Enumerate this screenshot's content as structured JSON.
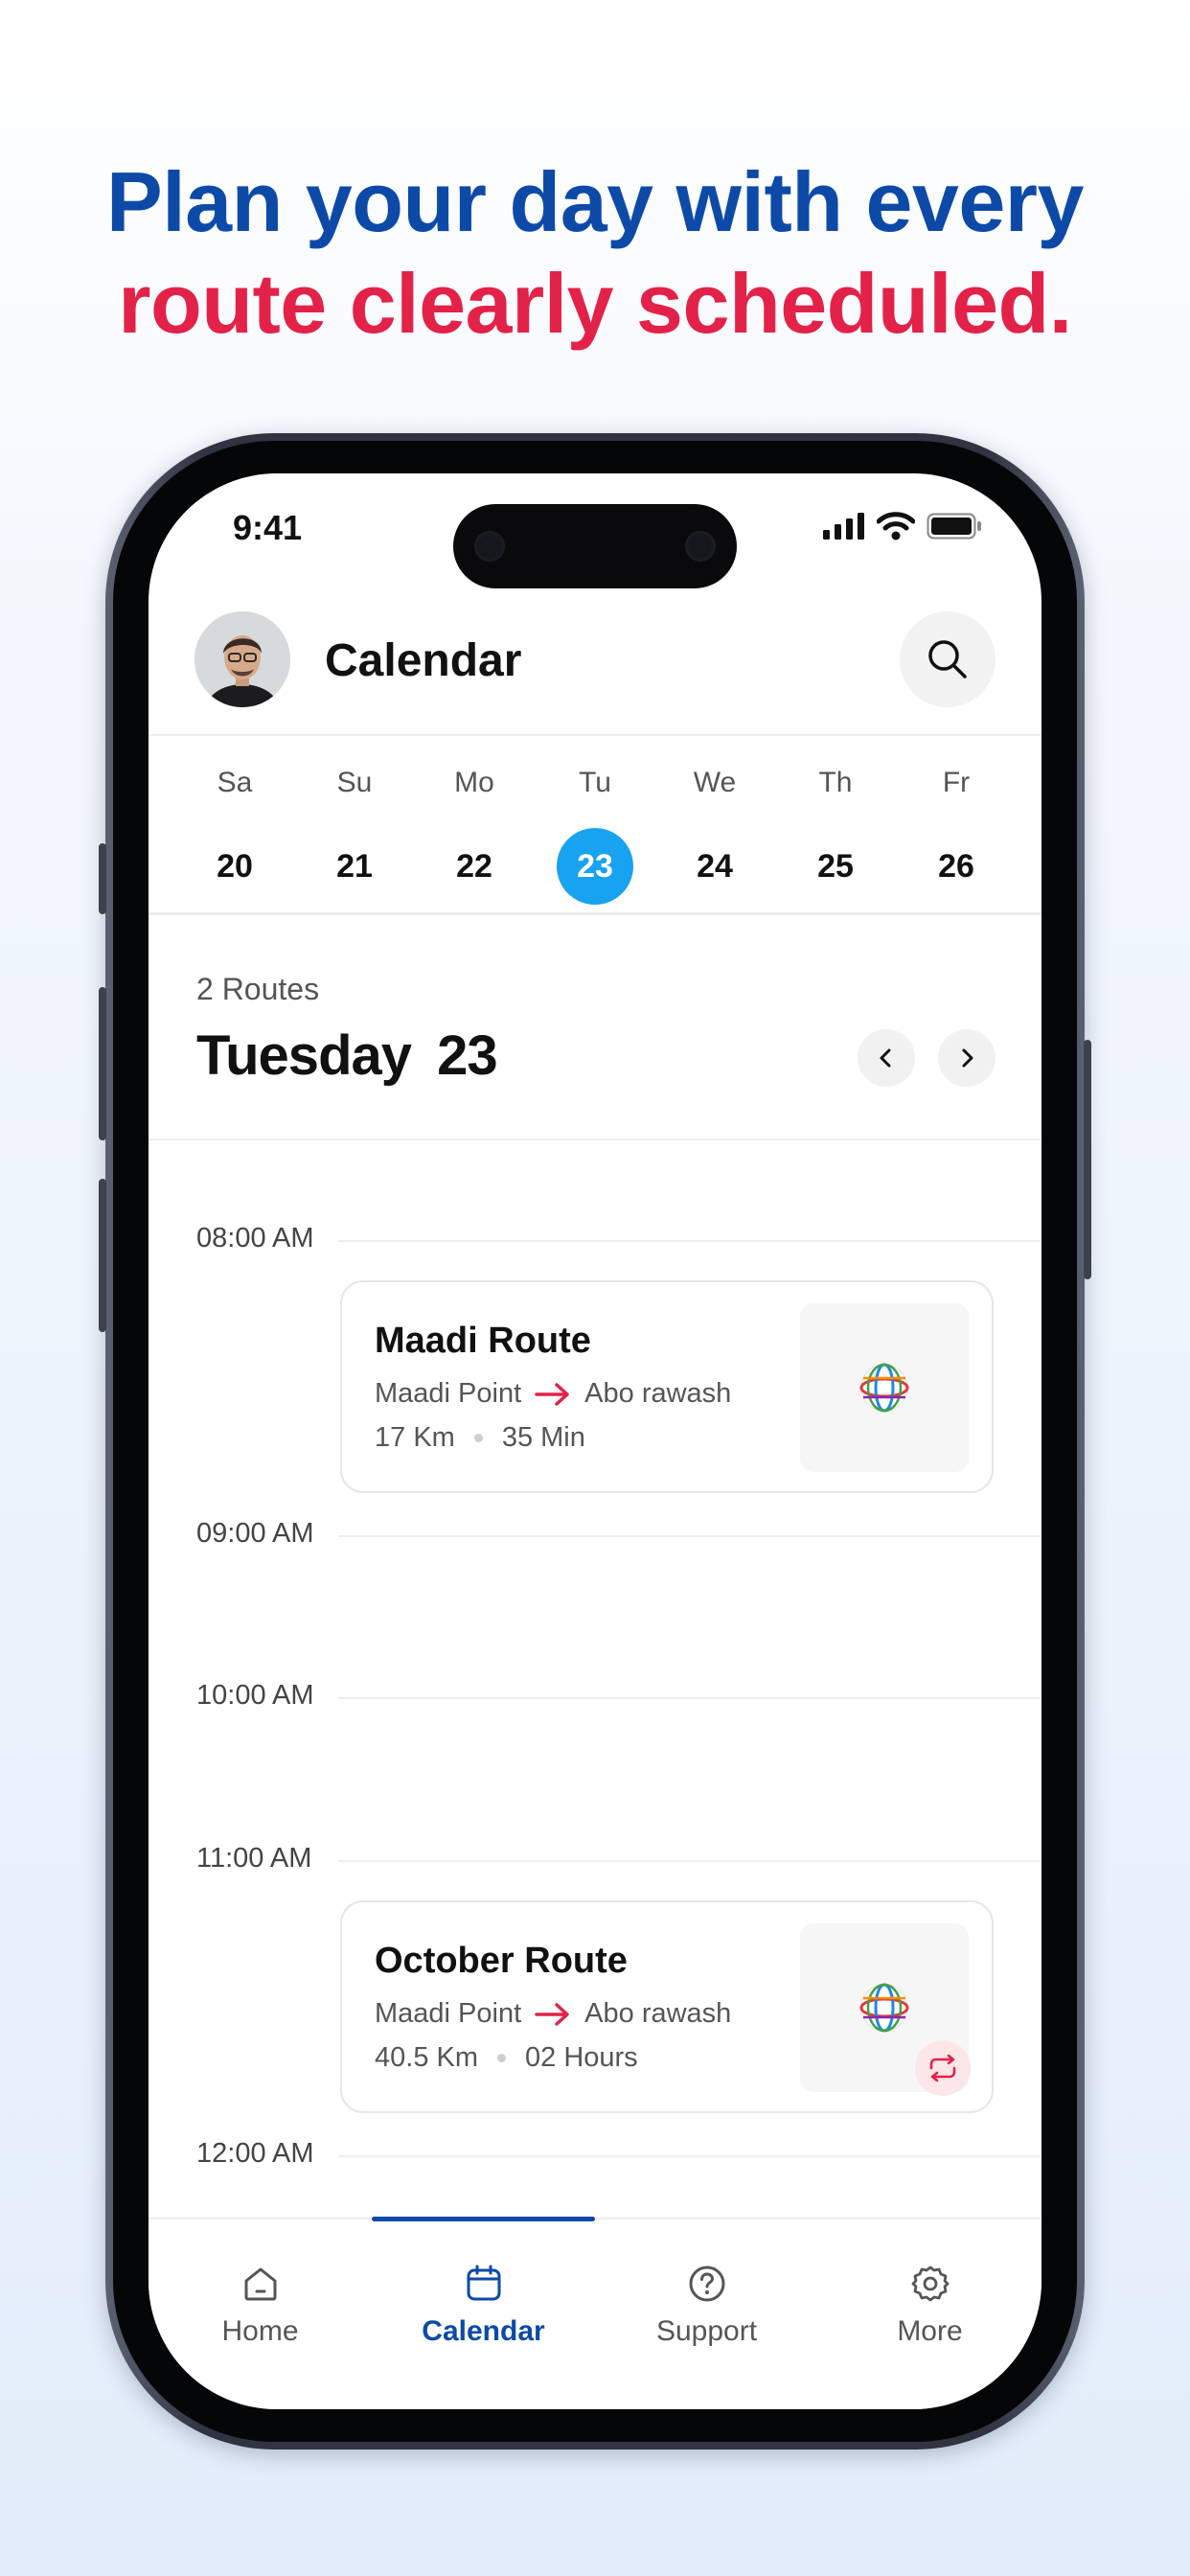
{
  "headline": {
    "line1": "Plan your day with every",
    "line2": "route clearly scheduled.",
    "line1_color": "#0d4aa8",
    "line2_color": "#e32249"
  },
  "status_bar": {
    "time": "9:41"
  },
  "header": {
    "title": "Calendar",
    "avatar_icon": "user-avatar",
    "search_icon": "search-icon"
  },
  "week": {
    "days": [
      {
        "name": "Sa",
        "num": "20"
      },
      {
        "name": "Su",
        "num": "21"
      },
      {
        "name": "Mo",
        "num": "22"
      },
      {
        "name": "Tu",
        "num": "23"
      },
      {
        "name": "We",
        "num": "24"
      },
      {
        "name": "Th",
        "num": "25"
      },
      {
        "name": "Fr",
        "num": "26"
      }
    ],
    "selected_index": 3,
    "selected_color": "#17a3ef"
  },
  "summary": {
    "count": "2 Routes",
    "day_name": "Tuesday",
    "day_num": "23"
  },
  "timeline": {
    "times": [
      "08:00 AM",
      "09:00 AM",
      "10:00 AM",
      "11:00 AM",
      "12:00 AM"
    ]
  },
  "routes": [
    {
      "name": "Maadi Route",
      "from": "Maadi Point",
      "to": "Abo rawash",
      "distance": "17 Km",
      "duration": "35 Min",
      "recurring": false
    },
    {
      "name": "October Route",
      "from": "Maadi Point",
      "to": "Abo rawash",
      "distance": "40.5 Km",
      "duration": "02 Hours",
      "recurring": true
    }
  ],
  "arrow_color": "#e32249",
  "tabbar": {
    "tabs": [
      {
        "label": "Home",
        "icon": "home-icon"
      },
      {
        "label": "Calendar",
        "icon": "calendar-icon"
      },
      {
        "label": "Support",
        "icon": "help-circle-icon"
      },
      {
        "label": "More",
        "icon": "gear-icon"
      }
    ],
    "active_index": 1,
    "active_color": "#0d4aa8"
  }
}
